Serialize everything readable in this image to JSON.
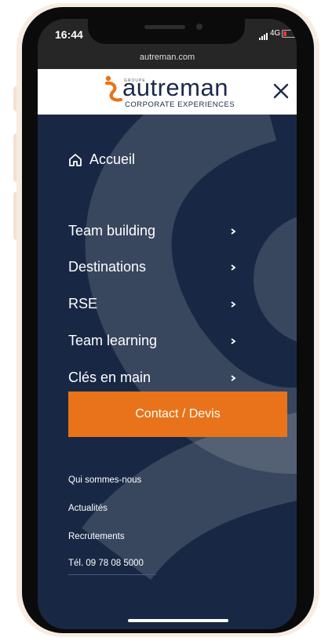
{
  "status_bar": {
    "time": "16:44",
    "network": "4G",
    "url": "autreman.com"
  },
  "header": {
    "logo_small": "GROUPE",
    "logo_name": "autreman",
    "logo_sub": "CORPORATE EXPERIENCES",
    "close_icon": "close-icon"
  },
  "menu": {
    "home": {
      "label": "Accueil",
      "icon": "home-icon"
    },
    "items": [
      {
        "label": "Team building"
      },
      {
        "label": "Destinations"
      },
      {
        "label": "RSE"
      },
      {
        "label": "Team learning"
      },
      {
        "label": "Clés en main"
      }
    ],
    "cta_label": "Contact / Devis",
    "secondary": [
      {
        "label": "Qui sommes-nous"
      },
      {
        "label": "Actualités"
      },
      {
        "label": "Recrutements"
      },
      {
        "label": "Tél. 09 78 08 5000"
      }
    ]
  },
  "colors": {
    "menu_bg": "#182844",
    "accent": "#e8731a",
    "header_bg": "#ffffff",
    "status_bg": "#262626"
  }
}
